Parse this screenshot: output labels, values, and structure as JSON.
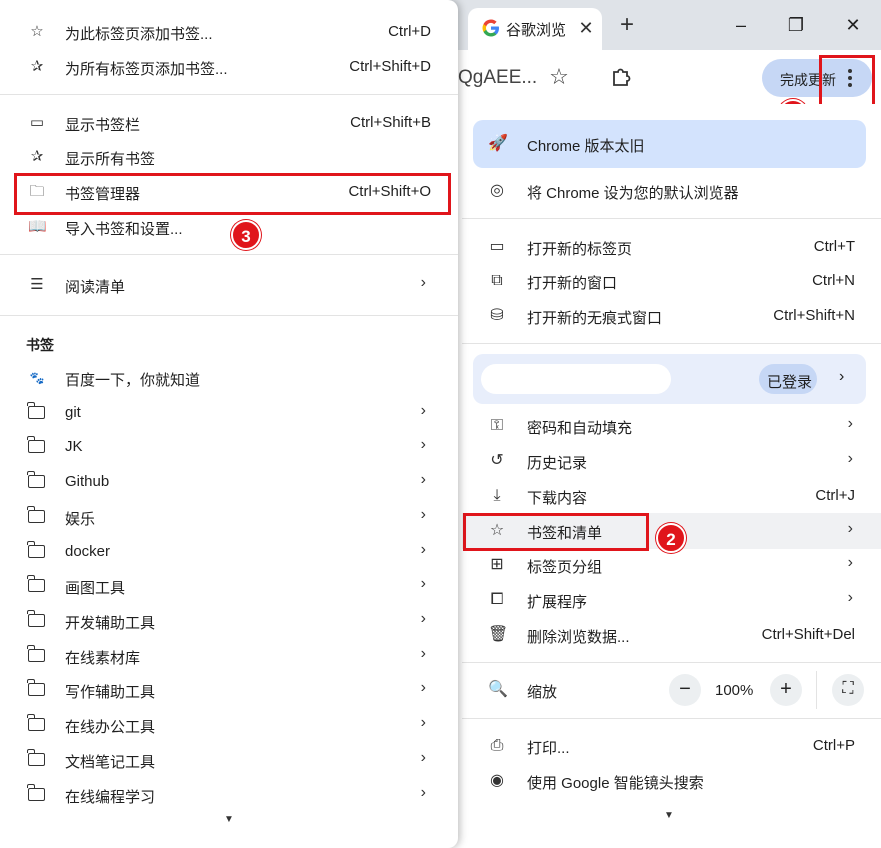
{
  "tab": {
    "title": "谷歌浏览"
  },
  "window": {
    "minimize": "–",
    "maximize": "❐",
    "close": "✕"
  },
  "toolbar": {
    "address_fragment": "QgAEE...",
    "update_label": "完成更新"
  },
  "annotations": {
    "step1": "1",
    "step2": "2",
    "step3": "3"
  },
  "chrome_menu": {
    "banner": "Chrome 版本太旧",
    "set_default": "将 Chrome 设为您的默认浏览器",
    "new_tab": {
      "label": "打开新的标签页",
      "shortcut": "Ctrl+T"
    },
    "new_window": {
      "label": "打开新的窗口",
      "shortcut": "Ctrl+N"
    },
    "incognito": {
      "label": "打开新的无痕式窗口",
      "shortcut": "Ctrl+Shift+N"
    },
    "profile_status": "已登录",
    "passwords": "密码和自动填充",
    "history": "历史记录",
    "downloads": {
      "label": "下载内容",
      "shortcut": "Ctrl+J"
    },
    "bookmarks_lists": "书签和清单",
    "tab_groups": "标签页分组",
    "extensions": "扩展程序",
    "clear_data": {
      "label": "删除浏览数据...",
      "shortcut": "Ctrl+Shift+Del"
    },
    "zoom": {
      "label": "缩放",
      "value": "100%",
      "minus": "−",
      "plus": "+"
    },
    "print": {
      "label": "打印...",
      "shortcut": "Ctrl+P"
    },
    "lens": "使用 Google 智能镜头搜索"
  },
  "bookmarks_menu": {
    "add_bookmark": {
      "label": "为此标签页添加书签...",
      "shortcut": "Ctrl+D"
    },
    "add_all": {
      "label": "为所有标签页添加书签...",
      "shortcut": "Ctrl+Shift+D"
    },
    "show_bar": {
      "label": "显示书签栏",
      "shortcut": "Ctrl+Shift+B"
    },
    "show_all": "显示所有书签",
    "manager": {
      "label": "书签管理器",
      "shortcut": "Ctrl+Shift+O"
    },
    "import": "导入书签和设置...",
    "reading_list": "阅读清单",
    "section_title": "书签",
    "baidu": "百度一下，你就知道",
    "folders": [
      "git",
      "JK",
      "Github",
      "娱乐",
      "docker",
      "画图工具",
      "开发辅助工具",
      "在线素材库",
      "写作辅助工具",
      "在线办公工具",
      "文档笔记工具",
      "在线编程学习"
    ]
  },
  "colors": {
    "accent": "#d3e3fd",
    "annotation_red": "#e0151b",
    "hover": "#f0f1f3"
  }
}
